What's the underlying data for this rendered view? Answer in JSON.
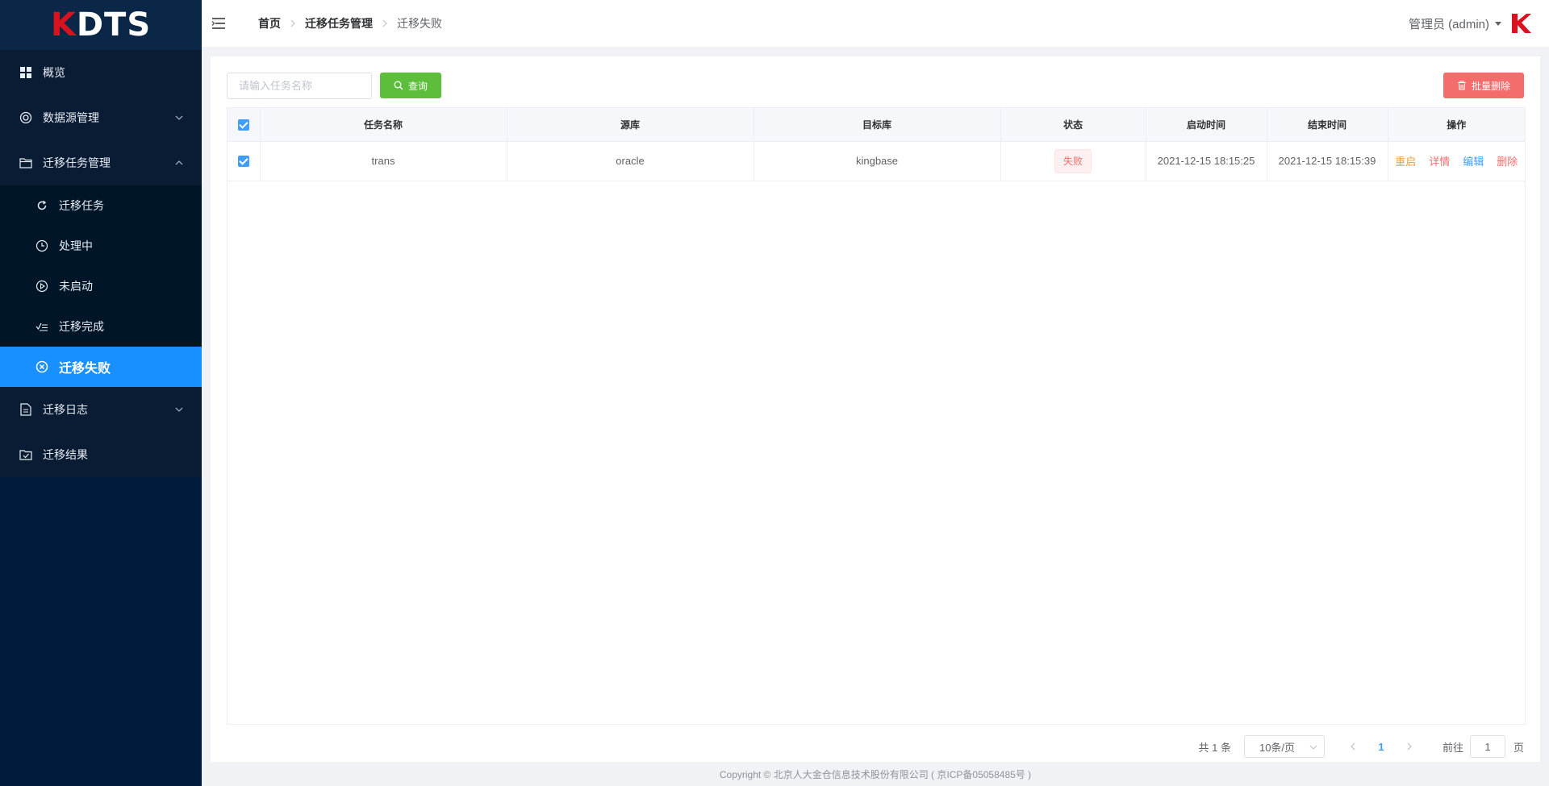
{
  "app": {
    "logo_text": "DTS",
    "logo_k": "K"
  },
  "sidebar": {
    "items": [
      {
        "label": "概览",
        "icon": "dashboard-icon"
      },
      {
        "label": "数据源管理",
        "icon": "datasource-icon",
        "expanded": false
      },
      {
        "label": "迁移任务管理",
        "icon": "folder-icon",
        "expanded": true,
        "children": [
          {
            "label": "迁移任务",
            "icon": "refresh-icon"
          },
          {
            "label": "处理中",
            "icon": "clock-icon"
          },
          {
            "label": "未启动",
            "icon": "play-circle-icon"
          },
          {
            "label": "迁移完成",
            "icon": "check-list-icon"
          },
          {
            "label": "迁移失败",
            "icon": "close-circle-icon",
            "active": true
          }
        ]
      },
      {
        "label": "迁移日志",
        "icon": "document-icon",
        "expanded": false
      },
      {
        "label": "迁移结果",
        "icon": "result-icon"
      }
    ]
  },
  "header": {
    "breadcrumb": [
      "首页",
      "迁移任务管理",
      "迁移失败"
    ],
    "user": "管理员 (admin)"
  },
  "toolbar": {
    "search_placeholder": "请输入任务名称",
    "query_label": "查询",
    "batch_delete_label": "批量删除"
  },
  "table": {
    "columns": [
      "任务名称",
      "源库",
      "目标库",
      "状态",
      "启动时间",
      "结束时间",
      "操作"
    ],
    "rows": [
      {
        "checked": true,
        "name": "trans",
        "source": "oracle",
        "target": "kingbase",
        "status": "失败",
        "start": "2021-12-15 18:15:25",
        "end": "2021-12-15 18:15:39",
        "ops": {
          "restart": "重启",
          "detail": "详情",
          "edit": "编辑",
          "delete": "删除"
        }
      }
    ]
  },
  "pagination": {
    "total": "共 1 条",
    "page_size": "10条/页",
    "current": "1",
    "goto_label": "前往",
    "goto_value": "1",
    "page_suffix": "页"
  },
  "footer": {
    "copyright": "Copyright © 北京人大金仓信息技术股份有限公司 ( 京ICP备05058485号 )"
  },
  "colors": {
    "sidebar_bg": "#001c3d",
    "active": "#1890ff",
    "query_btn": "#5cbe3a",
    "danger": "#f56c6c",
    "primary": "#409eff",
    "brand_red": "#d8121f"
  }
}
